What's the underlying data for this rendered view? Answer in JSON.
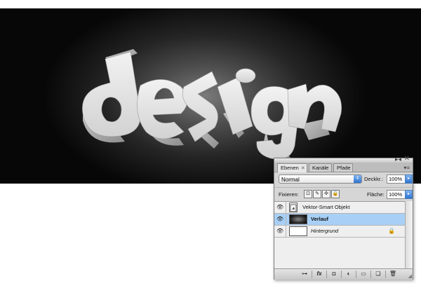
{
  "canvas": {
    "artwork_text": "design",
    "background_gradient": [
      "#7a7a7a",
      "#070707"
    ],
    "letter_face_color": "#e4e4e4",
    "letter_side_color": "#b0b0b0"
  },
  "layers_panel": {
    "collapse_glyph": "▸◂",
    "close_glyph": "✕",
    "tabs": [
      {
        "label": "Ebenen",
        "active": true,
        "close": "✕"
      },
      {
        "label": "Kanäle",
        "active": false
      },
      {
        "label": "Pfade",
        "active": false
      }
    ],
    "menu_glyph": "▾≡",
    "blend_mode": "Normal",
    "blend_arrow": "⇕",
    "opacity_label": "Deckkr.:",
    "opacity_value": "100%",
    "stepper_glyph": "▸",
    "lock_label": "Fixieren:",
    "lock_icons": [
      "lock-transparent-icon",
      "brush-icon",
      "move-icon",
      "lock-icon"
    ],
    "lock_glyphs": [
      "⊡",
      "✎",
      "✣",
      "🔒"
    ],
    "fill_label": "Fläche:",
    "fill_value": "100%",
    "eye_glyph": "👁",
    "layers": [
      {
        "name": "Vektor-Smart Objekt",
        "selected": false,
        "italic": false,
        "bold": false,
        "thumbnail": "smart-object-icon",
        "locked": false
      },
      {
        "name": "Verlauf",
        "selected": true,
        "italic": false,
        "bold": true,
        "thumbnail": "gradient-thumbnail",
        "locked": false
      },
      {
        "name": "Hintergrund",
        "selected": false,
        "italic": true,
        "bold": false,
        "thumbnail": "white-thumbnail",
        "locked": true
      }
    ],
    "layer_lock_glyph": "🔒",
    "bottom_buttons": [
      {
        "name": "link-layers-icon",
        "glyph": "⊶"
      },
      {
        "name": "fx-icon",
        "glyph": "fx"
      },
      {
        "name": "layer-mask-icon",
        "glyph": "◘"
      },
      {
        "name": "adjustment-layer-icon",
        "glyph": "◐"
      },
      {
        "name": "new-group-icon",
        "glyph": "▭"
      },
      {
        "name": "new-layer-icon",
        "glyph": "❏"
      },
      {
        "name": "trash-icon",
        "glyph": "🗑"
      }
    ],
    "resize_glyph": "◢",
    "accent_color": "#a8d0f6"
  }
}
